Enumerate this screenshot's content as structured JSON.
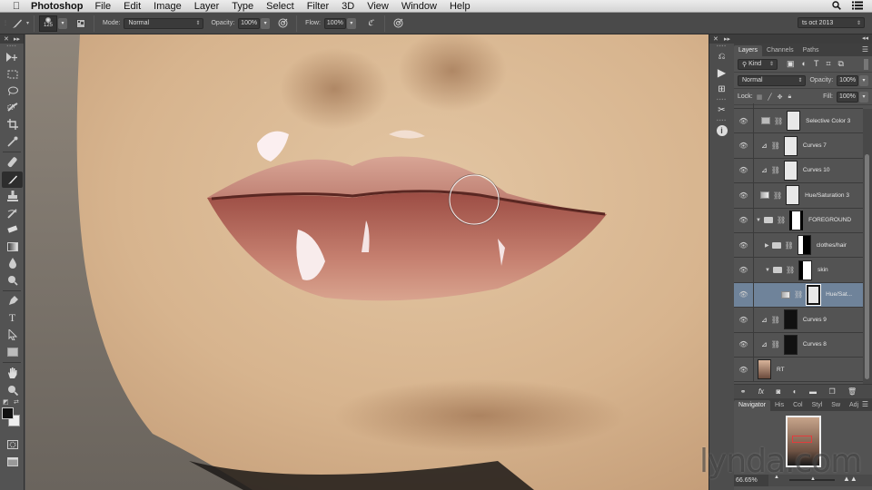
{
  "menubar": {
    "apple_icon": "",
    "app_name": "Photoshop",
    "items": [
      "File",
      "Edit",
      "Image",
      "Layer",
      "Type",
      "Select",
      "Filter",
      "3D",
      "View",
      "Window",
      "Help"
    ],
    "right_icons": [
      "search-icon",
      "list-icon"
    ]
  },
  "options_bar": {
    "brush_size": "125",
    "mode_label": "Mode:",
    "mode_value": "Normal",
    "opacity_label": "Opacity:",
    "opacity_value": "100%",
    "flow_label": "Flow:",
    "flow_value": "100%",
    "workspace_value": "ts oct 2013"
  },
  "toolbar": {
    "tools": [
      "move",
      "rectangular-marquee",
      "lasso",
      "quick-selection",
      "crop",
      "eyedropper",
      "spot-healing-brush",
      "brush",
      "clone-stamp",
      "history-brush",
      "eraser",
      "gradient",
      "blur",
      "dodge",
      "pen",
      "type",
      "path-selection",
      "rectangle",
      "hand",
      "zoom"
    ],
    "active_tool": "brush",
    "foreground_color": "#111111",
    "background_color": "#eeeeee"
  },
  "layers_panel": {
    "tabs": [
      "Layers",
      "Channels",
      "Paths"
    ],
    "active_tab": "Layers",
    "filter_kind": "Kind",
    "blend_mode": "Normal",
    "opacity_label": "Opacity:",
    "opacity_value": "100%",
    "lock_label": "Lock:",
    "fill_label": "Fill:",
    "fill_value": "100%",
    "layers": [
      {
        "name": "Selective Color 3",
        "type": "adjustment",
        "visible": true,
        "selected": false
      },
      {
        "name": "Curves 7",
        "type": "adjustment",
        "visible": true,
        "selected": false
      },
      {
        "name": "Curves 10",
        "type": "adjustment",
        "visible": true,
        "selected": false
      },
      {
        "name": "Hue/Saturation 3",
        "type": "adjustment",
        "visible": true,
        "selected": false
      },
      {
        "name": "FOREGROUND",
        "type": "group",
        "visible": true,
        "selected": false
      },
      {
        "name": "clothes/hair",
        "type": "group",
        "visible": true,
        "selected": false
      },
      {
        "name": "skin",
        "type": "group",
        "visible": true,
        "selected": false
      },
      {
        "name": "Hue/Sat...",
        "type": "adjustment",
        "visible": true,
        "selected": true
      },
      {
        "name": "Curves 9",
        "type": "adjustment",
        "visible": true,
        "selected": false
      },
      {
        "name": "Curves 8",
        "type": "adjustment",
        "visible": true,
        "selected": false
      },
      {
        "name": "RT",
        "type": "image",
        "visible": true,
        "selected": false
      }
    ]
  },
  "navigator_panel": {
    "tabs": [
      "Navigator",
      "His",
      "Col",
      "Styl",
      "Sw",
      "Adj"
    ],
    "active_tab": "Navigator",
    "zoom_value": "66.65%"
  },
  "watermark": "lynda.com"
}
